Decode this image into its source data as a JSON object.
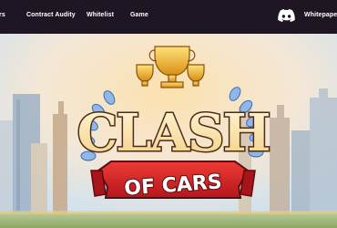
{
  "nav": {
    "cut_left_label": "rs",
    "items": [
      {
        "label": "Contract Audity"
      },
      {
        "label": "Whitelist"
      },
      {
        "label": "Game"
      }
    ],
    "discord_icon": "discord-icon",
    "whitepaper_label": "Whitepaper"
  },
  "hero": {
    "logo_top": "CLASH",
    "logo_bottom": "OF CARS",
    "logo_text_color": "#fbe9b6",
    "logo_outline_color": "#4a2a1c",
    "ribbon_color": "#d8232a",
    "trophy_color": "#f2b826",
    "laurel_color": "#8fb7e8",
    "sky_top": "#f7efe1",
    "sky_glow": "#fbd8a0"
  }
}
